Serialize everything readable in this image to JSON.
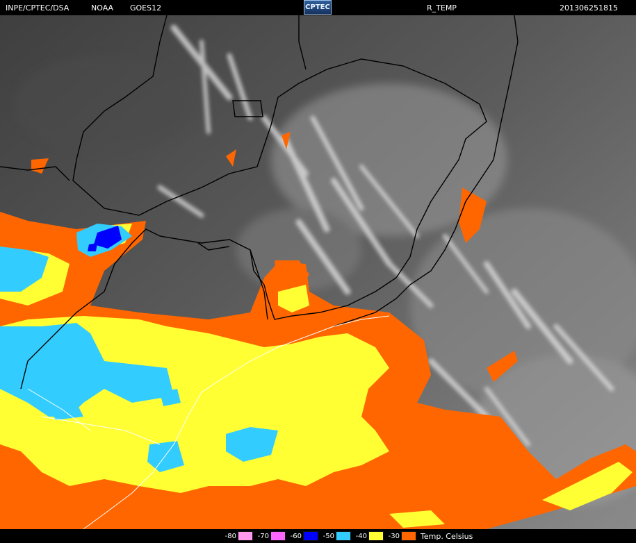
{
  "header": {
    "source": "INPE/CPTEC/DSA",
    "agency": "NOAA",
    "satellite": "GOES12",
    "logo_text": "CPTEC",
    "product": "R_TEMP",
    "timestamp": "201306251815"
  },
  "legend": {
    "unit_label": "Temp. Celsius",
    "items": [
      {
        "label": "-80",
        "color": "#ff99ee"
      },
      {
        "label": "-70",
        "color": "#ff66ff"
      },
      {
        "label": "-60",
        "color": "#0000ff"
      },
      {
        "label": "-50",
        "color": "#33ccff"
      },
      {
        "label": "-40",
        "color": "#ffff33"
      },
      {
        "label": "-30",
        "color": "#ff6600"
      }
    ]
  },
  "colors": {
    "background_gray": "#6b6b6b",
    "cloud_white": "#d8d8d8",
    "border_line": "#000000",
    "coast_line": "#ffffff"
  }
}
